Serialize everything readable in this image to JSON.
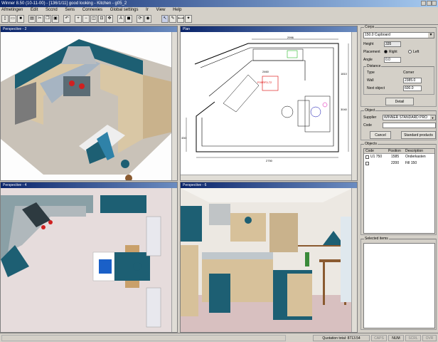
{
  "window": {
    "title": "Winner 8.50 (10-11-00) - [136/1/11] good looking - Kitchen - g05_2"
  },
  "menu": [
    "Afmetingen",
    "Edit",
    "Sccnd",
    "Sens",
    "Connexies",
    "Global settings",
    "Ir",
    "View",
    "Help"
  ],
  "toolbar": {
    "icons": [
      "new-icon",
      "open-icon",
      "save-icon",
      "print-icon",
      "cut-icon",
      "copy-icon",
      "paste-icon",
      "undo-icon",
      "zoom-in-icon",
      "zoom-out-icon",
      "zoom-fit-icon",
      "text-icon",
      "render-icon",
      "rotate-icon",
      "pointer-icon",
      "draw-icon",
      "measure-icon",
      "camera-icon",
      "light-icon"
    ]
  },
  "viewports": [
    {
      "title": "Perspective - 2"
    },
    {
      "title": "Plan"
    },
    {
      "title": "Perspective - 4"
    },
    {
      "title": "Perspective - 6"
    }
  ],
  "plan": {
    "dims": [
      "2996",
      "2460",
      "1810",
      "330",
      "3040",
      "1110",
      "330",
      "920",
      "2750",
      "5600",
      "450",
      "580"
    ],
    "label": "F09RF3-72"
  },
  "props": {
    "group_label": "Corps",
    "item_value": "150.0 Cupboard",
    "height_label": "Height",
    "height_value": "335",
    "placement_label": "Placement",
    "radio_right": "Right",
    "radio_left": "Left",
    "angle_label": "Angle",
    "angle_value": "0.0",
    "distance_group": "Distance",
    "type_label": "Type",
    "corner_label": "Corner",
    "wall_label": "Wall",
    "wall_value": "2385.0",
    "next_label": "Next object",
    "next_value": "600.0",
    "detail_button": "Detail"
  },
  "object": {
    "group_label": "Object",
    "supplier_label": "Supplier",
    "supplier_value": "WINNER STANDARD PRO",
    "code_label": "Code",
    "code_value": "",
    "cancel_button": "Cancel",
    "standard_button": "Standard products"
  },
  "objects": {
    "group_label": "Objects",
    "columns": [
      "Code",
      "Position",
      "Description"
    ],
    "rows": [
      [
        "U1 750",
        "1585",
        "Onderkasten"
      ],
      [
        "",
        "2200",
        "Fill 150"
      ]
    ]
  },
  "selected": {
    "group_label": "Selected items"
  },
  "status": {
    "quotation": "Quotation total: 8713.54",
    "panels": [
      "CAPS",
      "NUM",
      "SCRL",
      "OVR"
    ]
  }
}
